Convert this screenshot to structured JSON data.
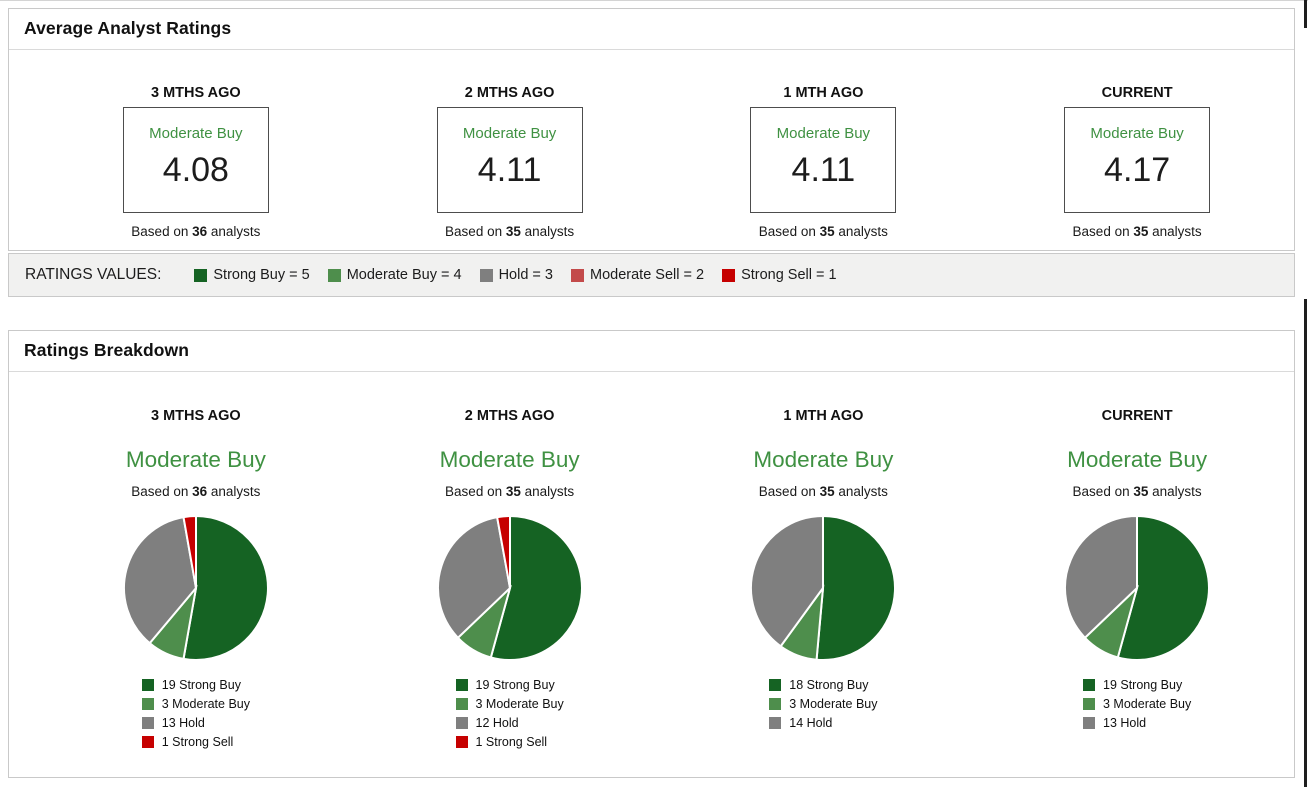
{
  "colors": {
    "strong_buy": "#156323",
    "moderate_buy": "#4e8e4c",
    "hold": "#7f7f7f",
    "moderate_sell": "#c34a4a",
    "strong_sell": "#c60000",
    "rating_text_green": "#3f9142"
  },
  "shared": {
    "based_on": "Based on",
    "analysts": "analysts"
  },
  "average_panel": {
    "title": "Average Analyst Ratings",
    "cards": [
      {
        "period": "3 MTHS AGO",
        "rating_label": "Moderate Buy",
        "score": "4.08",
        "analysts": "36"
      },
      {
        "period": "2 MTHS AGO",
        "rating_label": "Moderate Buy",
        "score": "4.11",
        "analysts": "35"
      },
      {
        "period": "1 MTH AGO",
        "rating_label": "Moderate Buy",
        "score": "4.11",
        "analysts": "35"
      },
      {
        "period": "CURRENT",
        "rating_label": "Moderate Buy",
        "score": "4.17",
        "analysts": "35"
      }
    ]
  },
  "ratings_values": {
    "label": "RATINGS VALUES:",
    "items": [
      {
        "label": "Strong Buy = 5",
        "color": "#156323"
      },
      {
        "label": "Moderate Buy = 4",
        "color": "#4e8e4c"
      },
      {
        "label": "Hold = 3",
        "color": "#7f7f7f"
      },
      {
        "label": "Moderate Sell = 2",
        "color": "#c34a4a"
      },
      {
        "label": "Strong Sell = 1",
        "color": "#c60000"
      }
    ]
  },
  "breakdown_panel": {
    "title": "Ratings Breakdown"
  },
  "chart_data": [
    {
      "type": "pie",
      "period": "3 MTHS AGO",
      "title": "Moderate Buy",
      "analysts": "36",
      "labels": [
        "Strong Buy",
        "Moderate Buy",
        "Hold",
        "Strong Sell"
      ],
      "values": [
        19,
        3,
        13,
        1
      ],
      "colors": [
        "#156323",
        "#4e8e4c",
        "#7f7f7f",
        "#c60000"
      ],
      "legend": [
        "19 Strong Buy",
        "3 Moderate Buy",
        "13 Hold",
        "1 Strong Sell"
      ],
      "legend_position": "bottom",
      "start_angle_deg": 0,
      "direction": "clockwise"
    },
    {
      "type": "pie",
      "period": "2 MTHS AGO",
      "title": "Moderate Buy",
      "analysts": "35",
      "labels": [
        "Strong Buy",
        "Moderate Buy",
        "Hold",
        "Strong Sell"
      ],
      "values": [
        19,
        3,
        12,
        1
      ],
      "colors": [
        "#156323",
        "#4e8e4c",
        "#7f7f7f",
        "#c60000"
      ],
      "legend": [
        "19 Strong Buy",
        "3 Moderate Buy",
        "12 Hold",
        "1 Strong Sell"
      ],
      "legend_position": "bottom",
      "start_angle_deg": 0,
      "direction": "clockwise"
    },
    {
      "type": "pie",
      "period": "1 MTH AGO",
      "title": "Moderate Buy",
      "analysts": "35",
      "labels": [
        "Strong Buy",
        "Moderate Buy",
        "Hold"
      ],
      "values": [
        18,
        3,
        14
      ],
      "colors": [
        "#156323",
        "#4e8e4c",
        "#7f7f7f"
      ],
      "legend": [
        "18 Strong Buy",
        "3 Moderate Buy",
        "14 Hold"
      ],
      "legend_position": "bottom",
      "start_angle_deg": 0,
      "direction": "clockwise"
    },
    {
      "type": "pie",
      "period": "CURRENT",
      "title": "Moderate Buy",
      "analysts": "35",
      "labels": [
        "Strong Buy",
        "Moderate Buy",
        "Hold"
      ],
      "values": [
        19,
        3,
        13
      ],
      "colors": [
        "#156323",
        "#4e8e4c",
        "#7f7f7f"
      ],
      "legend": [
        "19 Strong Buy",
        "3 Moderate Buy",
        "13 Hold"
      ],
      "legend_position": "bottom",
      "start_angle_deg": 0,
      "direction": "clockwise"
    }
  ]
}
